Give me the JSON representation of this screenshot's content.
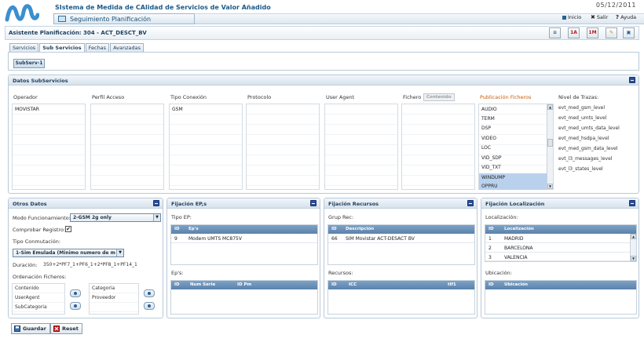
{
  "app": {
    "title": "SIstema de Medida de CAlidad de Servicios de Valor Añadido",
    "subtitle": "Seguimiento Planificación",
    "date": "05/12/2011",
    "links": {
      "inicio": "Inicio",
      "salir": "Salir",
      "ayuda": "Ayuda"
    }
  },
  "assistant": {
    "title": "Asistente Planificación: 304 - ACT_DESCT_BV",
    "tools": [
      "list-icon",
      "calendar-1a-icon",
      "calendar-1m-icon",
      "tools-icon",
      "window-icon"
    ],
    "tool_labels": {
      "t1a": "1A",
      "t1m": "1M"
    }
  },
  "tabs": [
    "Servicios",
    "Sub Servicios",
    "Fechas",
    "Avanzadas"
  ],
  "active_tab": "Sub Servicios",
  "subserv_button": "SubServ-1",
  "datos_subservicios": {
    "title": "Datos SubServicios",
    "columns": {
      "operador": "Operador",
      "perfil": "Perfil Acceso",
      "tipo_conexion": "Tipo Conexión",
      "protocolo": "Protocolo",
      "user_agent": "User Agent",
      "fichero": "Fichero",
      "contenido_btn": "Contenido",
      "publicacion": "Publicación Ficheros",
      "nivel_trazas": "Nivel de Trazas:"
    },
    "operador_value": "MOVISTAR",
    "tipo_conexion_value": "GSM",
    "publicacion_items": [
      "AUDIO",
      "TERM",
      "DSP",
      "VIDEO",
      "LOC",
      "VID_SDP",
      "VID_TXT",
      "WINDUMP",
      "OPPRU"
    ],
    "publicacion_selected": [
      "WINDUMP",
      "OPPRU"
    ],
    "nivel_trazas_items": [
      "evt_med_gsm_level",
      "evt_med_umts_level",
      "evt_med_umts_data_level",
      "evt_med_hsdpa_level",
      "evt_med_gsm_data_level",
      "evt_l3_messages_level",
      "evt_l3_states_level"
    ]
  },
  "otros_datos": {
    "title": "Otros Datos",
    "modo_label": "Modo Funcionamiento:",
    "modo_value": "2-GSM 2g only",
    "comprobar_label": "Comprobar Registro:",
    "comprobar_checked": "✔",
    "tipo_conm_label": "Tipo Conmutación:",
    "tipo_conm_value": "1-Sim Emulada (Minimo numero de m",
    "duracion_label": "Duración:",
    "duracion_value": "350+2*PF7_1+PF6_1+2*PF8_1+PF14_1",
    "ordenacion_label": "Ordenación Ficheros:",
    "left_list": [
      "Contenido",
      "UserAgent",
      "SubCategoria"
    ],
    "right_list": [
      "Categoria",
      "Proveedor"
    ]
  },
  "fijacion_eps": {
    "title": "Fijación EP,s",
    "tipo_ep_label": "Tipo EP:",
    "grid1_headers": [
      "ID",
      "Ep's"
    ],
    "grid1_rows": [
      [
        "9",
        "Modem UMTS MC875V"
      ]
    ],
    "eps_label": "Ep's:",
    "grid2_headers": [
      "ID",
      "Num Serie",
      "ID Pm"
    ]
  },
  "fijacion_recursos": {
    "title": "Fijación Recursos",
    "grup_label": "Grup Rec:",
    "grid1_headers": [
      "ID",
      "Descripción"
    ],
    "grid1_rows": [
      [
        "66",
        "SIM Movistar ACT-DESACT BV"
      ]
    ],
    "recursos_label": "Recursos:",
    "grid2_headers": [
      "ID",
      "ICC",
      "tlf1"
    ]
  },
  "fijacion_localizacion": {
    "title": "Fijación Localización",
    "loc_label": "Localización:",
    "grid1_headers": [
      "ID",
      "Localización"
    ],
    "grid1_rows": [
      [
        "1",
        "MADRID"
      ],
      [
        "2",
        "BARCELONA"
      ],
      [
        "3",
        "VALENCIA"
      ]
    ],
    "ubic_label": "Ubicación:",
    "grid2_headers": [
      "ID",
      "Ubicación"
    ]
  },
  "footer": {
    "guardar": "Guardar",
    "reset": "Reset"
  },
  "colors": {
    "accent": "#1a5a8a",
    "grid_head": "#5a82ab",
    "brand_logo": "#3a8fd0",
    "selection": "#b9d1ec"
  }
}
